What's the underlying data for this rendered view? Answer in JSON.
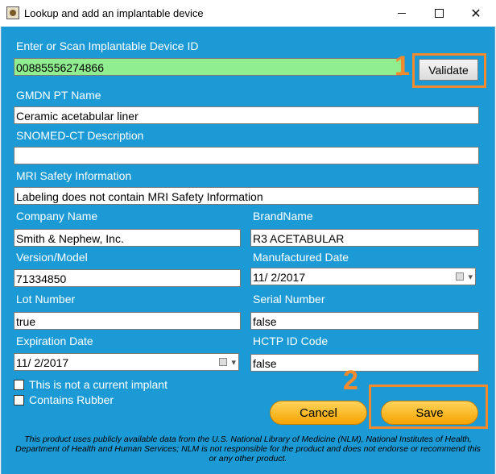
{
  "window": {
    "title": "Lookup and add an implantable device",
    "close_glyph": "✕"
  },
  "device": {
    "id_label": "Enter or Scan Implantable Device ID",
    "id_value": "00885556274866",
    "validate_label": "Validate",
    "id_field_color": "#90ee90"
  },
  "gmdn": {
    "label": "GMDN PT Name",
    "value": "Ceramic acetabular liner"
  },
  "snomed": {
    "label": "SNOMED-CT Description",
    "value": ""
  },
  "mri": {
    "label": "MRI Safety Information",
    "value": "Labeling does not contain MRI Safety Information"
  },
  "company": {
    "label": "Company Name",
    "value": "Smith & Nephew, Inc."
  },
  "brand": {
    "label": "BrandName",
    "value": "R3 ACETABULAR"
  },
  "version": {
    "label": "Version/Model",
    "value": "71334850"
  },
  "manufactured": {
    "label": "Manufactured Date",
    "value": "11/  2/2017",
    "arrow": "▾"
  },
  "lot": {
    "label": "Lot Number",
    "value": "true"
  },
  "serial": {
    "label": "Serial Number",
    "value": "false"
  },
  "expiration": {
    "label": "Expiration Date",
    "value": "11/  2/2017",
    "arrow": "▾"
  },
  "hctp": {
    "label": "HCTP ID Code",
    "value": "false"
  },
  "options": {
    "not_current_label": "This is not a current implant",
    "not_current_checked": false,
    "rubber_label": "Contains Rubber",
    "rubber_checked": false
  },
  "actions": {
    "cancel_label": "Cancel",
    "save_label": "Save"
  },
  "callouts": {
    "one": "1",
    "two": "2",
    "color": "#f28a2e"
  },
  "disclaimer": "This product uses publicly available data from the U.S. National Library of Medicine (NLM), National Institutes of Health, Department of Health and Human Services; NLM is not responsible for the product and does not endorse or recommend this or any other product.",
  "colors": {
    "background": "#1c9ad6",
    "button_accent": "#f7a400"
  }
}
